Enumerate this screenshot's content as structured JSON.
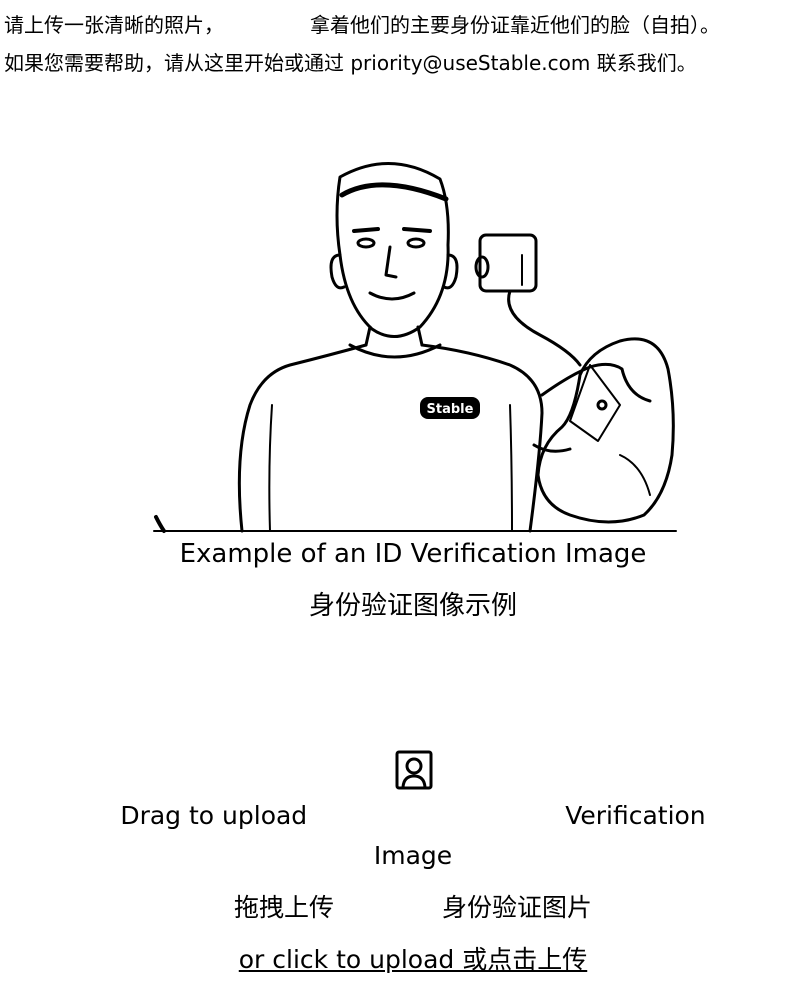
{
  "instructions": {
    "line1_start": "请上传一张清晰的照片，",
    "line1_end": "拿着他们的主要身份证靠近他们的脸（自拍）。",
    "line2": "如果您需要帮助，请从这里开始或通过 priority@useStable.com 联系我们。"
  },
  "example": {
    "caption_en": "Example of an ID Verification Image",
    "caption_zh": "身份验证图像示例",
    "shirt_logo": "Stable"
  },
  "upload": {
    "icon": "user-portrait-icon",
    "title_start": "Drag to upload",
    "title_end": "Verification",
    "title_line2": "Image",
    "zh_start": "拖拽上传",
    "zh_end": "身份验证图片",
    "link": "or click to upload 或点击上传"
  }
}
